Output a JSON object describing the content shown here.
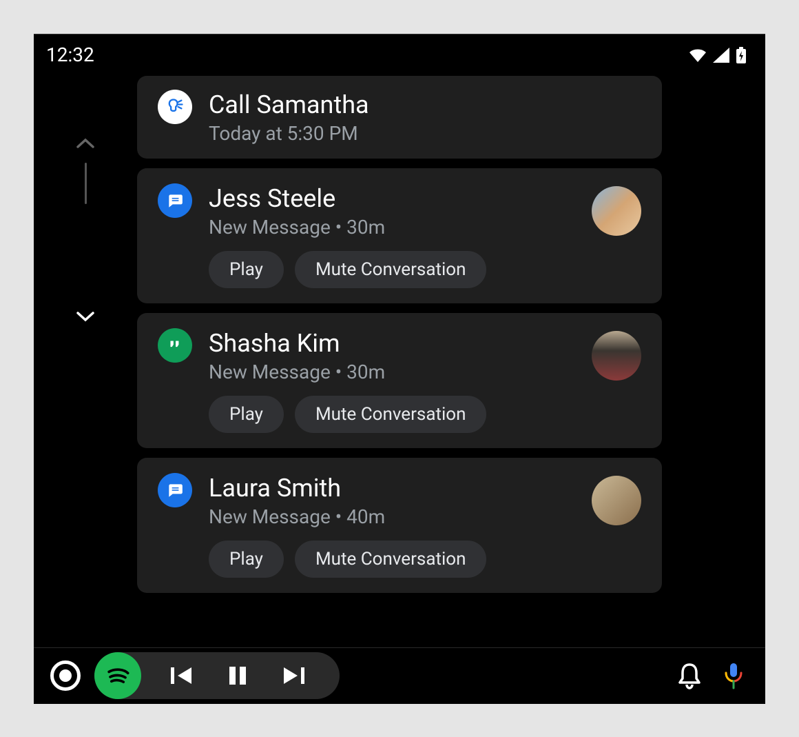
{
  "statusBar": {
    "time": "12:32"
  },
  "reminder": {
    "title": "Call Samantha",
    "subtitle": "Today at 5:30 PM"
  },
  "notifications": [
    {
      "app": "messages",
      "title": "Jess Steele",
      "subtitle": "New Message • 30m",
      "playLabel": "Play",
      "muteLabel": "Mute Conversation"
    },
    {
      "app": "hangouts",
      "title": "Shasha Kim",
      "subtitle": "New Message • 30m",
      "playLabel": "Play",
      "muteLabel": "Mute Conversation"
    },
    {
      "app": "messages",
      "title": "Laura Smith",
      "subtitle": "New Message • 40m",
      "playLabel": "Play",
      "muteLabel": "Mute Conversation"
    }
  ]
}
